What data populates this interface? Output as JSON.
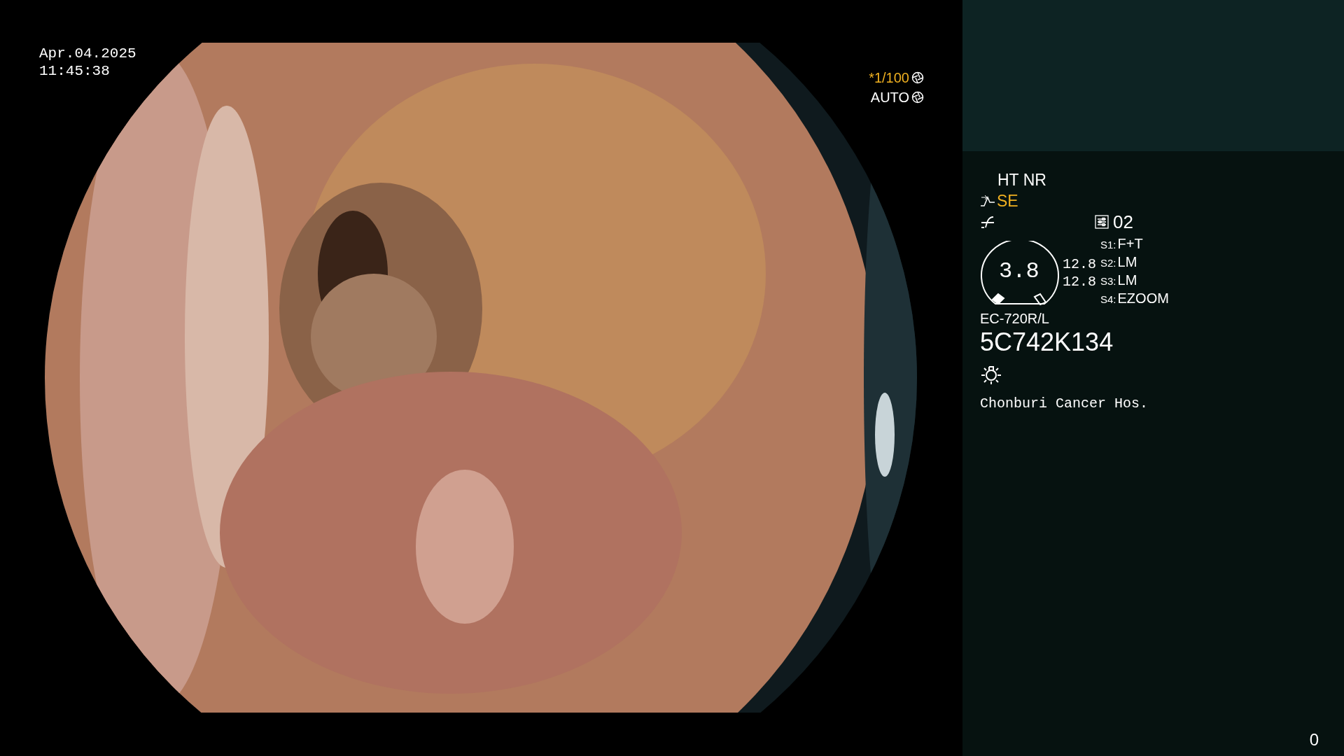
{
  "capture": {
    "date": "Apr.04.2025",
    "time": "11:45:38"
  },
  "exposure": {
    "shutter": "*1/100",
    "mode": "AUTO"
  },
  "processor": {
    "enhancement_modes": "HT NR",
    "structure_enhancement": "SE",
    "preset": "02",
    "gauge_value": "3.8",
    "readings": [
      "12.8",
      "12.8"
    ],
    "switches": [
      {
        "label": "S1:",
        "value": "F+T"
      },
      {
        "label": "S2:",
        "value": "LM"
      },
      {
        "label": "S3:",
        "value": "LM"
      },
      {
        "label": "S4:",
        "value": "EZOOM"
      }
    ],
    "scope_model": "EC-720R/L",
    "serial": "5C742K134",
    "institution": "Chonburi Cancer Hos."
  },
  "counter": "0"
}
